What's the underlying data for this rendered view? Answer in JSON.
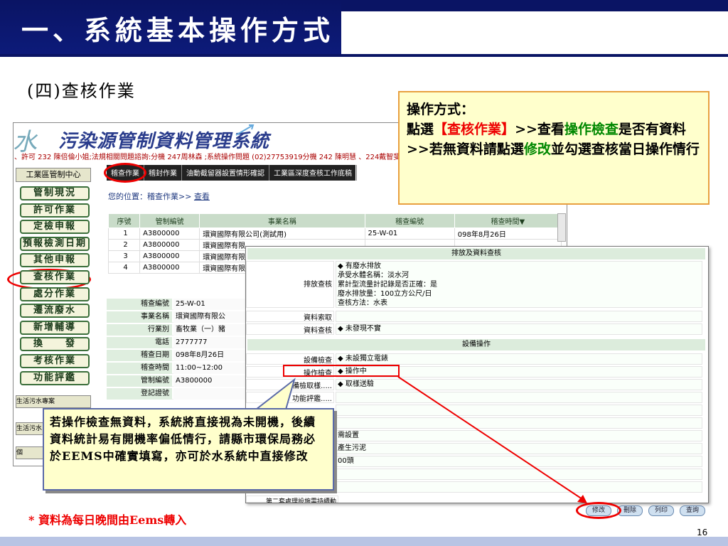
{
  "slide": {
    "title": "一、系統基本操作方式",
    "subtitle": "(四)查核作業",
    "page_number": "16",
    "note": "* 資料為每日晚間由Eems轉入"
  },
  "app": {
    "logo_water": "水",
    "logo_text": "污染源管制資料管理系統",
    "ticker": "、許可 232 陳倍倫小姐;法規相關問題諮詢:分機 247周林森 ;系統操作問題 (02)27753919分機 242 陳明慧 、224戴智斐、239林"
  },
  "nav": {
    "header": "工業區管制中心",
    "items": [
      "管制現況",
      "許可作業",
      "定檢申報",
      "預報檢測日期",
      "其他申報",
      "查核作業",
      "處分作業",
      "遷流廢水",
      "新增輔導",
      "換　　發",
      "考核作業",
      "功能評鑑"
    ],
    "section2": "生活污水專案",
    "section3": "生活污水",
    "section4": "個"
  },
  "tabs": [
    "稽查作業",
    "稽封作業",
    "油動截留器設置情形確認",
    "工業區深度查核工作底稿"
  ],
  "location": {
    "label": "您的位置：",
    "path": "稽查作業>> ",
    "link": "查看"
  },
  "table": {
    "headers": [
      "序號",
      "管制編號",
      "事業名稱",
      "稽查編號",
      "稽查時間▼"
    ],
    "rows": [
      [
        "1",
        "A3800000",
        "環資國際有限公司(測試用)",
        "25-W-01",
        "098年8月26日"
      ],
      [
        "2",
        "A3800000",
        "環資國際有限",
        "",
        ""
      ],
      [
        "3",
        "A3800000",
        "環資國際有限",
        "",
        ""
      ],
      [
        "4",
        "A3800000",
        "環資國際有限",
        "",
        ""
      ]
    ]
  },
  "detail": [
    {
      "label": "稽查編號",
      "value": "25-W-01"
    },
    {
      "label": "事業名稱",
      "value": "環資國際有限公"
    },
    {
      "label": "行業別",
      "value": "畜牧業（一）豬"
    },
    {
      "label": "電話",
      "value": "2777777"
    },
    {
      "label": "稽查日期",
      "value": "098年8月26日"
    },
    {
      "label": "稽查時間",
      "value": "11:00~12:00"
    },
    {
      "label": "管制編號",
      "value": "A3800000"
    },
    {
      "label": "登記證號",
      "value": ""
    }
  ],
  "panel": {
    "section1": "排放及資料查核",
    "discharge_label": "排放查核",
    "discharge_lines": [
      "◆ 有廢水排放",
      "承受水體名稱：淡水河",
      "累計型流量計記錄是否正確：是",
      "廢水排放量：100立方公尺/日",
      "查核方法：水表"
    ],
    "data_request_label": "資料索取",
    "data_check_label": "資料查核",
    "data_check_value": "◆ 未發現不實",
    "section2": "設備操作",
    "equip_check_label": "設備檢查",
    "equip_check_value": "◆ 未設獨立電錶",
    "op_check_label": "操作檢查",
    "op_check_value": "◆ 操作中",
    "sampling_label": "備檢取樣.....",
    "sampling_value": "◆ 取樣送驗",
    "eval_label": "功能評鑑.....",
    "extra1": "需設置",
    "extra2": "產生污泥",
    "extra3": "00頭",
    "bottom_cut": "第二套處理設施需持續動",
    "buttons": [
      "修改",
      "刪除",
      "列印",
      "查詢"
    ]
  },
  "callouts": {
    "c1_title": "操作方式：",
    "c1_pre": "點選",
    "c1_bracket_open": "【",
    "c1_red": "查核作業",
    "c1_bracket_close": "】",
    "c1_mid": ">>查看",
    "c1_green1": "操作檢查",
    "c1_mid2": "是否有資料>>若無資料請點選",
    "c1_green2": "修改",
    "c1_end": "並勾選查核當日操作情行",
    "c2": "若操作檢查無資料，系統將直接視為未開機，後續資料統計易有開機率偏低情行，請縣市環保局務必於EEMS中確實填寫，亦可於水系統中直接修改"
  },
  "colors": {
    "title_bg": "#0a1464",
    "highlight": "#e00000",
    "callout_bg": "#ffffcc",
    "green_text": "#008800"
  }
}
